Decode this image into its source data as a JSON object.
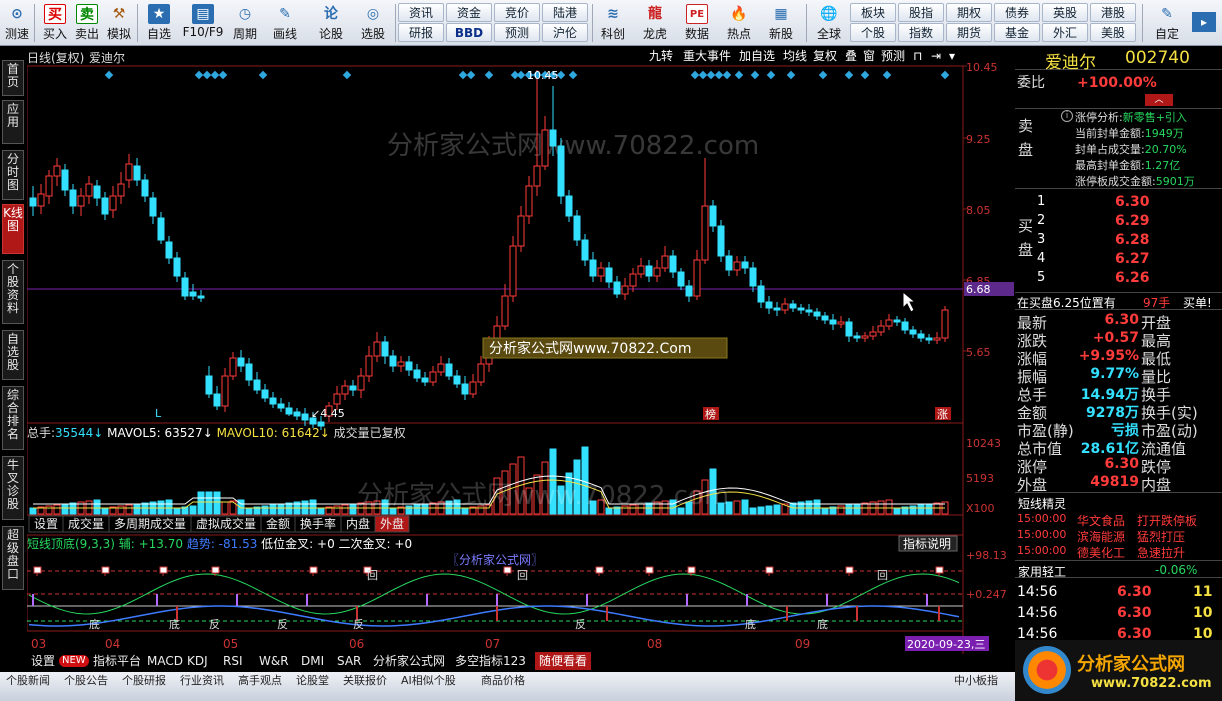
{
  "toolbar": {
    "buttons": [
      {
        "label": "测速",
        "icon": "speed-icon",
        "glyph": "⊙"
      },
      {
        "label": "买入",
        "icon": "buy-icon",
        "glyph": "买"
      },
      {
        "label": "卖出",
        "icon": "sell-icon",
        "glyph": "卖"
      },
      {
        "label": "模拟",
        "icon": "hammer-icon",
        "glyph": "⚒"
      },
      {
        "label": "自选",
        "icon": "favorite-icon",
        "glyph": "★"
      },
      {
        "label": "F10/F9",
        "icon": "f10-icon",
        "glyph": "▤"
      },
      {
        "label": "周期",
        "icon": "clock-icon",
        "glyph": "◷"
      },
      {
        "label": "画线",
        "icon": "pencil-icon",
        "glyph": "✎"
      },
      {
        "label": "论股",
        "icon": "discuss-icon",
        "glyph": "论"
      },
      {
        "label": "选股",
        "icon": "select-stock-icon",
        "glyph": "◎"
      }
    ],
    "small": [
      [
        "资讯",
        "资金",
        "竞价",
        "陆港"
      ],
      [
        "研报",
        "BBD",
        "预测",
        "沪伦"
      ]
    ],
    "buttons2": [
      {
        "label": "科创",
        "icon": "star-market-icon",
        "glyph": "≋"
      },
      {
        "label": "龙虎",
        "icon": "dragon-tiger-icon",
        "glyph": "龍"
      },
      {
        "label": "数据",
        "icon": "data-icon",
        "glyph": "PE"
      },
      {
        "label": "热点",
        "icon": "hot-icon",
        "glyph": "🔥"
      },
      {
        "label": "新股",
        "icon": "new-stock-icon",
        "glyph": "▦"
      },
      {
        "label": "全球",
        "icon": "globe-icon",
        "glyph": "🌐"
      }
    ],
    "small2": [
      [
        "板块",
        "股指",
        "期权",
        "债券",
        "英股",
        "港股"
      ],
      [
        "个股",
        "指数",
        "期货",
        "基金",
        "外汇",
        "美股"
      ]
    ],
    "custom": {
      "label": "自定",
      "icon": "customize-icon",
      "glyph": "✎"
    }
  },
  "left_tabs": [
    "首页",
    "应用",
    "分时图",
    "K线图",
    "个股资料",
    "自选股",
    "综合排名",
    "牛叉诊股",
    "超级盘口"
  ],
  "kline": {
    "title": "日线(复权)",
    "stock_name": "爱迪尔",
    "buttons": [
      "九转",
      "重大事件",
      "加自选",
      "均线",
      "复权",
      "叠",
      "窗",
      "预测"
    ],
    "price_ticks": [
      "10.45",
      "9.25",
      "8.05",
      "6.85",
      "6.68",
      "5.65"
    ],
    "high_label": "10.45",
    "low_label": "4.45",
    "watermark": "分析家公式网www.70822.com",
    "watermark_box": "分析家公式网www.70822.Com",
    "markers": [
      "L",
      "榜",
      "涨"
    ]
  },
  "volume": {
    "label_total": "总手:",
    "total": "35544",
    "ma5_label": "MAVOL5:",
    "ma5": "63527",
    "ma10_label": "MAVOL10:",
    "ma10": "61642",
    "note": "成交量已复权",
    "ticks": [
      "10243",
      "5193",
      "X100"
    ],
    "tabs": [
      "设置",
      "成交量",
      "多周期成交量",
      "虚拟成交量",
      "金额",
      "换手率",
      "内盘",
      "外盘"
    ]
  },
  "indicator": {
    "name": "短线顶底(9,3,3)",
    "fu_label": "辅:",
    "fu": "+13.70",
    "trend_label": "趋势:",
    "trend": "-81.53",
    "cross1_label": "低位金叉:",
    "cross1": "+0",
    "cross2_label": "二次金叉:",
    "cross2": "+0",
    "explain": "指标说明",
    "ticks": [
      "+98.13",
      "+0.247"
    ],
    "title_tag": "〖分析家公式网〗",
    "marks": [
      "底",
      "底",
      "反",
      "反",
      "反",
      "反",
      "底",
      "底",
      "回",
      "回",
      "回"
    ]
  },
  "dates": [
    "03",
    "04",
    "05",
    "06",
    "07",
    "08",
    "09"
  ],
  "cursor_date": "2020-09-23,三",
  "bottom_tabs": [
    "设置",
    "NEW",
    "指标平台",
    "MACD",
    "KDJ",
    "RSI",
    "W&R",
    "DMI",
    "SAR",
    "分析家公式网",
    "多空指标123",
    "随便看看"
  ],
  "strip_tabs": [
    "个股新闻",
    "个股公告",
    "个股研报",
    "行业资讯",
    "高手观点",
    "论股堂",
    "关联报价",
    "AI相似个股",
    "商品价格"
  ],
  "strip_right": "中小板指",
  "right": {
    "name": "爱迪尔",
    "code": "002740",
    "weibi_label": "委比",
    "weibi": "+100.00%",
    "sell_label": "卖盘",
    "limit_lines": [
      {
        "k": "涨停分析:",
        "v": "新零售+引入"
      },
      {
        "k": "当前封单金额:",
        "v": "1949万"
      },
      {
        "k": "封单占成交量:",
        "v": "20.70%"
      },
      {
        "k": "最高封单金额:",
        "v": "1.27亿"
      },
      {
        "k": "涨停板成交金额:",
        "v": "5901万"
      }
    ],
    "buy_label": "买盘",
    "bids": [
      [
        "1",
        "6.30"
      ],
      [
        "2",
        "6.29"
      ],
      [
        "3",
        "6.28"
      ],
      [
        "4",
        "6.27"
      ],
      [
        "5",
        "6.26"
      ]
    ],
    "queue_text": "在买盘6.25位置有",
    "queue_qty": "97手",
    "queue_tag": "买单!",
    "stats": [
      [
        "最新",
        "6.30",
        "开盘",
        ""
      ],
      [
        "涨跌",
        "+0.57",
        "最高",
        ""
      ],
      [
        "涨幅",
        "+9.95%",
        "最低",
        ""
      ],
      [
        "振幅",
        "9.77%",
        "量比",
        ""
      ],
      [
        "总手",
        "14.94万",
        "换手",
        ""
      ],
      [
        "金额",
        "9278万",
        "换手(实)",
        ""
      ],
      [
        "市盈(静)",
        "亏损",
        "市盈(动)",
        ""
      ],
      [
        "总市值",
        "28.61亿",
        "流通值",
        ""
      ],
      [
        "涨停",
        "6.30",
        "跌停",
        ""
      ],
      [
        "外盘",
        "49819",
        "内盘",
        ""
      ]
    ],
    "sprite_title": "短线精灵",
    "sprites": [
      [
        "15:00:00",
        "华文食品",
        "打开跌停板"
      ],
      [
        "15:00:00",
        "滨海能源",
        "猛烈打压"
      ],
      [
        "15:00:00",
        "德美化工",
        "急速拉升"
      ]
    ],
    "sector": "家用轻工",
    "sector_chg": "-0.06%",
    "ticks": [
      [
        "14:56",
        "6.30",
        "11"
      ],
      [
        "14:56",
        "6.30",
        "10"
      ],
      [
        "14:56",
        "6.30",
        "10"
      ]
    ],
    "logo": "分析家公式网",
    "logo_url": "www.70822.com"
  },
  "colors": {
    "up": "#ff3b3b",
    "down": "#34e0ff",
    "ma5": "#ffffff",
    "ma10": "#f5e042",
    "highlight": "#7a1fb0",
    "axis_bg": "#5d2a8c"
  }
}
